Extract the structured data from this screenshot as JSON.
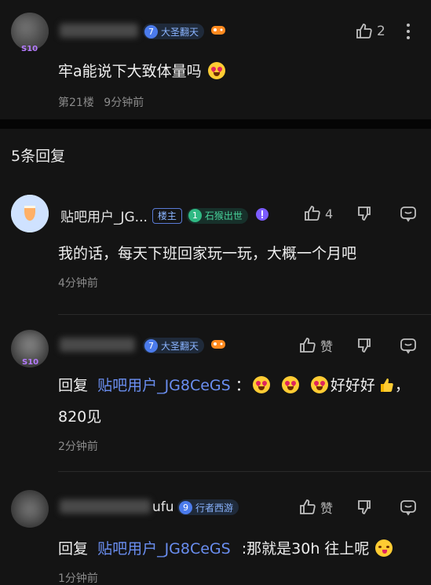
{
  "top_comment": {
    "level": "7",
    "level_title": "大圣翻天",
    "like_count": "2",
    "text": "牢a能说下大致体量吗",
    "floor": "第21楼",
    "time": "9分钟前",
    "avatar_tag": "S10"
  },
  "replies_header": "5条回复",
  "replies": [
    {
      "username": "贴吧用户_JG...",
      "host_tag": "楼主",
      "level": "1",
      "level_title": "石猴出世",
      "like_count": "4",
      "text": "我的话，每天下班回家玩一玩，大概一个月吧",
      "time": "4分钟前"
    },
    {
      "level": "7",
      "level_title": "大圣翻天",
      "like_label": "赞",
      "reply_prefix": "回复",
      "reply_target": "贴吧用户_JG8CeGS",
      "text_after": "：",
      "text_tail": "好好好",
      "text_tail2": "，",
      "text_line2": "820见",
      "time": "2分钟前",
      "avatar_tag": "S10"
    },
    {
      "username_tail": "ufu",
      "level": "9",
      "level_title": "行者西游",
      "like_label": "赞",
      "reply_prefix": "回复",
      "reply_target": "贴吧用户_JG8CeGS",
      "text_after": ":那就是30h 往上呢",
      "time": "1分钟前"
    }
  ],
  "colors": {
    "background": "#141414",
    "link": "#6a8ef0",
    "meta": "#8b8b8b"
  },
  "icons": [
    "thumb-up-icon",
    "more-icon",
    "thumb-down-icon",
    "comment-icon",
    "game-controller-icon",
    "emoji-heart-eyes-icon",
    "emoji-yum-icon",
    "thumbs-up-emoji-icon",
    "moon-jar-avatar-icon"
  ]
}
